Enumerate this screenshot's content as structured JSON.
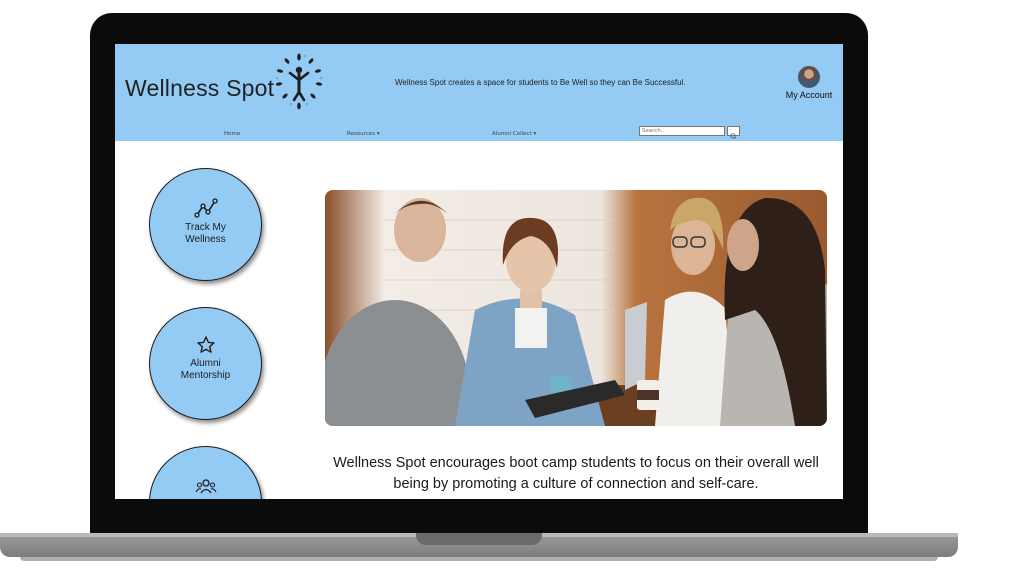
{
  "brand": {
    "name": "Wellness Spot"
  },
  "header": {
    "tagline": "Wellness Spot creates a space for students to Be Well so they can Be Successful.",
    "account_label": "My Account"
  },
  "nav": {
    "items": [
      {
        "label": "Home"
      },
      {
        "label": "Resources ▾"
      },
      {
        "label": "Alumni Collect ▾"
      }
    ],
    "search_placeholder": "Search.."
  },
  "cards": [
    {
      "label_line1": "Track My",
      "label_line2": "Wellness",
      "icon": "chart-line-icon"
    },
    {
      "label_line1": "Alumni",
      "label_line2": "Mentorship",
      "icon": "star-icon"
    },
    {
      "label_line1": "",
      "label_line2": "",
      "icon": "group-icon"
    }
  ],
  "main": {
    "description": "Wellness Spot encourages boot camp students to focus on their overall well being by promoting a culture of connection and self-care."
  },
  "colors": {
    "header_bg": "#93cbf5",
    "card_bg": "#93cbf5",
    "bezel": "#0b0b0b"
  }
}
